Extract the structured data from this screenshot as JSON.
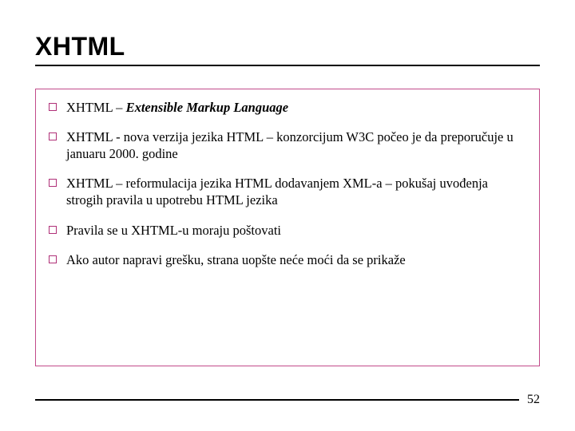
{
  "title": "XHTML",
  "bullets": [
    {
      "prefix": "XHTML – ",
      "emph": "Extensible Markup Language",
      "rest": ""
    },
    {
      "prefix": "XHTML - nova verzija jezika HTML – konzorcijum W3C počeo je da preporučuje u januaru 2000. godine",
      "emph": "",
      "rest": ""
    },
    {
      "prefix": "XHTML – reformulacija jezika HTML dodavanjem XML-a – pokušaj uvođenja strogih pravila u upotrebu HTML jezika",
      "emph": "",
      "rest": ""
    },
    {
      "prefix": "Pravila se u XHTML-u moraju poštovati",
      "emph": "",
      "rest": ""
    },
    {
      "prefix": "Ako autor napravi grešku, strana uopšte neće moći da se prikaže",
      "emph": "",
      "rest": ""
    }
  ],
  "page_number": "52"
}
